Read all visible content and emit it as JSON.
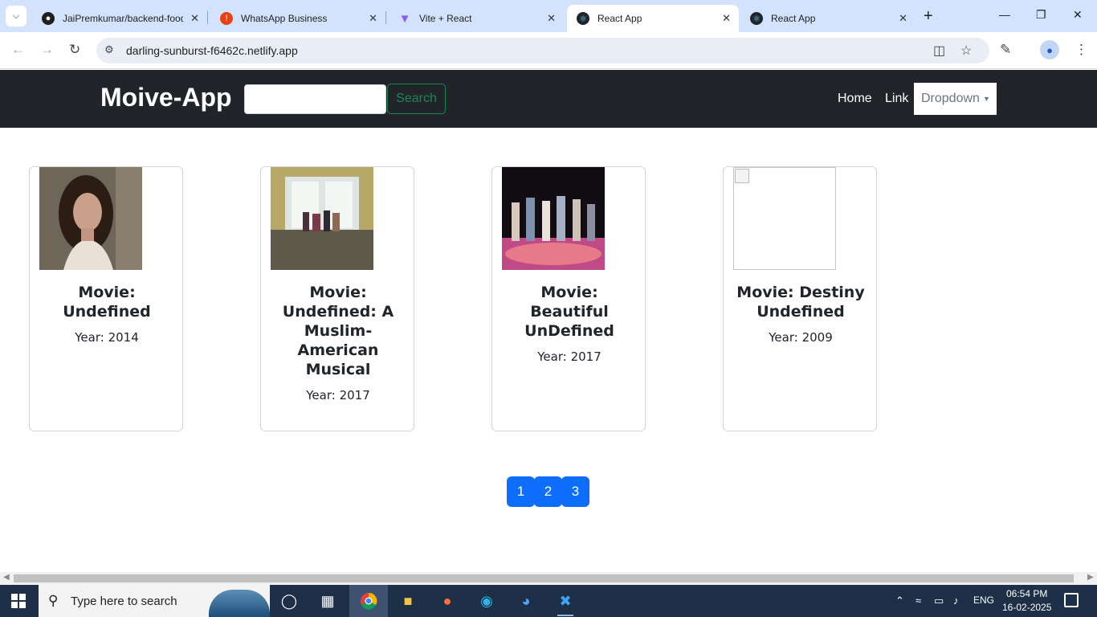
{
  "browser": {
    "tabs": [
      {
        "title": "JaiPremkumar/backend-food",
        "icon": "github-icon"
      },
      {
        "title": "WhatsApp Business",
        "icon": "whatsapp-icon"
      },
      {
        "title": "Vite + React",
        "icon": "vite-icon"
      },
      {
        "title": "React App",
        "icon": "react-icon",
        "active": true
      },
      {
        "title": "React App",
        "icon": "react-icon"
      }
    ],
    "url": "darling-sunburst-f6462c.netlify.app"
  },
  "app": {
    "brand": "Moive-App",
    "search_value": "",
    "search_button": "Search",
    "nav": {
      "home": "Home",
      "link": "Link",
      "dropdown": "Dropdown"
    }
  },
  "movies": [
    {
      "title": "Movie: Undefined",
      "year": "Year: 2014",
      "poster": "portrait-photo"
    },
    {
      "title": "Movie: Undefined: A Muslim-American Musical",
      "year": "Year: 2017",
      "poster": "hallway-photo"
    },
    {
      "title": "Movie: Beautiful UnDefined",
      "year": "Year: 2017",
      "poster": "dance-photo"
    },
    {
      "title": "Movie: Destiny Undefined",
      "year": "Year: 2009",
      "poster": "broken-image"
    }
  ],
  "pagination": [
    "1",
    "2",
    "3"
  ],
  "taskbar": {
    "search_placeholder": "Type here to search",
    "language": "ENG",
    "time": "06:54 PM",
    "date": "16-02-2025"
  }
}
